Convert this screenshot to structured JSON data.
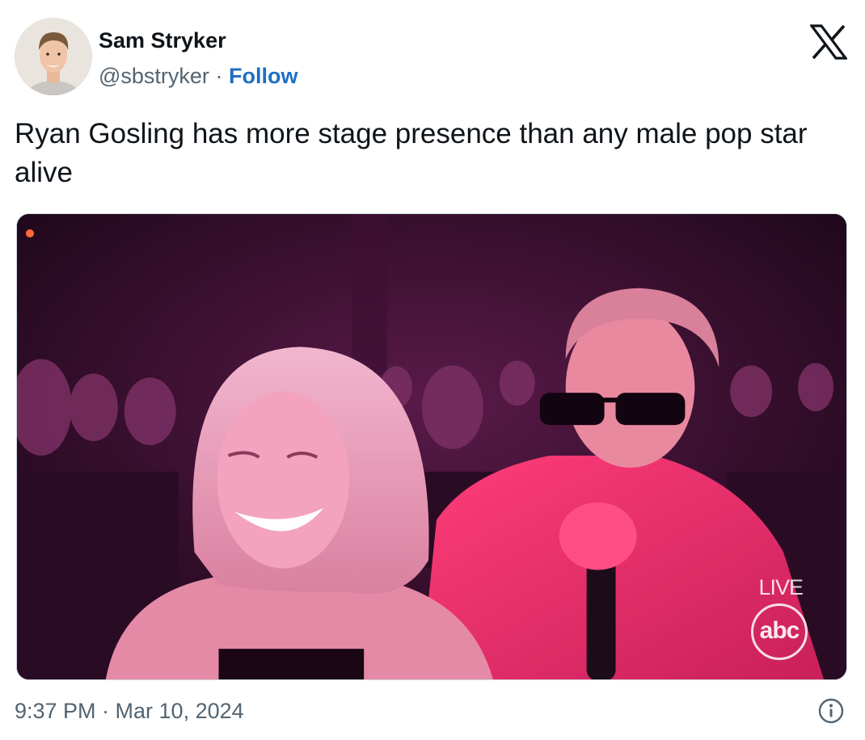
{
  "author": {
    "display_name": "Sam Stryker",
    "handle": "@sbstryker",
    "separator": "·",
    "follow_label": "Follow",
    "avatar_icon": "avatar-photo"
  },
  "brand": {
    "logo_icon": "x-logo-icon"
  },
  "tweet": {
    "text": "Ryan Gosling has more stage presence than any male pop star alive"
  },
  "media": {
    "type": "photo",
    "overlay_live": "LIVE",
    "overlay_network": "abc"
  },
  "footer": {
    "timestamp": "9:37 PM · Mar 10, 2024",
    "info_icon": "info-icon"
  },
  "colors": {
    "text_primary": "#0f1419",
    "text_secondary": "#536471",
    "follow_link": "#1d6fc4",
    "border": "#cfd9de"
  }
}
